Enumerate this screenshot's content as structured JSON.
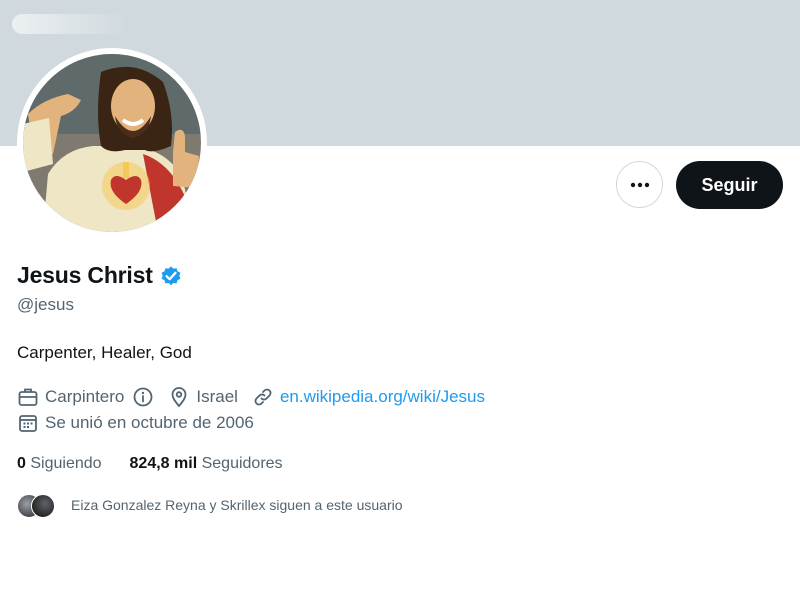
{
  "profile": {
    "name": "Jesus Christ",
    "handle": "@jesus",
    "bio": "Carpenter, Healer, God",
    "category": "Carpintero",
    "location": "Israel",
    "website": "en.wikipedia.org/wiki/Jesus",
    "joined": "Se unió en octubre de 2006",
    "following_count": "0",
    "following_label": "Siguiendo",
    "followers_count": "824,8 mil",
    "followers_label": "Seguidores",
    "followed_by": "Eiza Gonzalez Reyna y Skrillex siguen a este usuario"
  },
  "actions": {
    "more_icon": "more-horizontal-icon",
    "follow_label": "Seguir"
  },
  "icons": {
    "verified": "verified-badge-icon",
    "category": "briefcase-icon",
    "info": "info-icon",
    "location": "location-pin-icon",
    "website": "link-icon",
    "joined": "calendar-icon"
  },
  "colors": {
    "banner": "#cfd9de",
    "accent": "#1d9bf0",
    "text": "#0f1419",
    "secondary": "#536471",
    "button": "#0f1419"
  }
}
